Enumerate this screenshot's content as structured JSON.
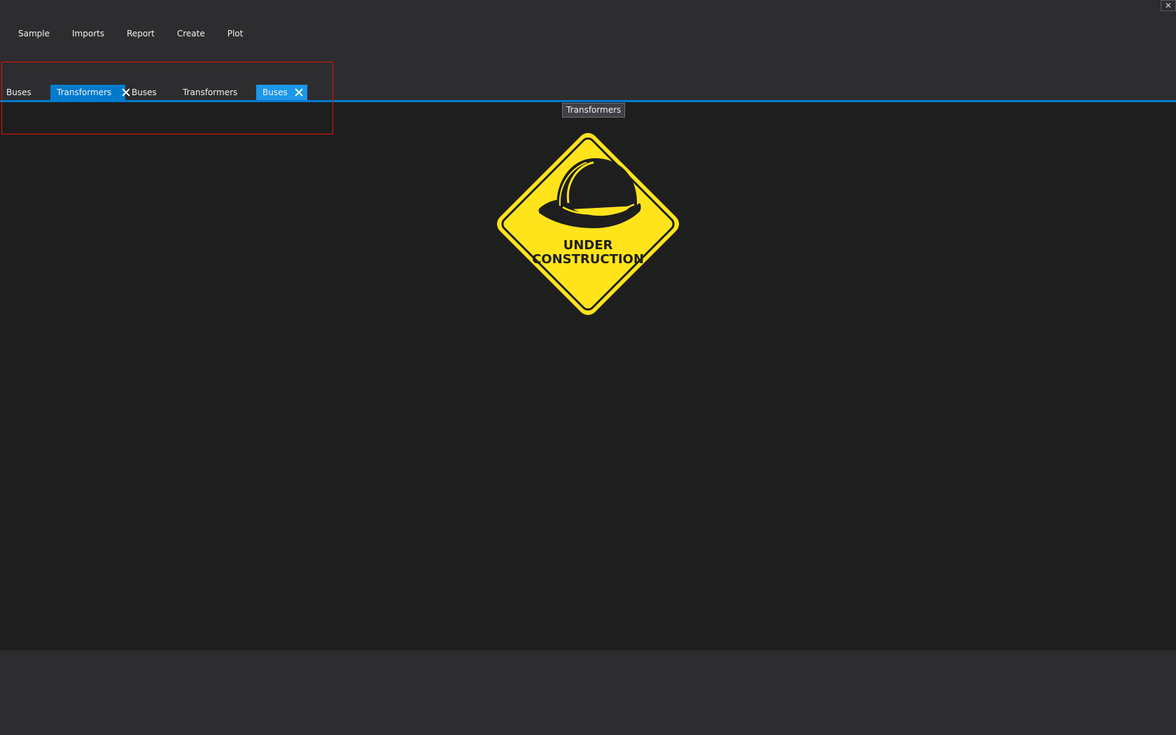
{
  "window": {
    "close_glyph": "✕"
  },
  "menu": {
    "items": [
      {
        "label": "Sample"
      },
      {
        "label": "Imports"
      },
      {
        "label": "Report"
      },
      {
        "label": "Create"
      },
      {
        "label": "Plot"
      }
    ]
  },
  "tabs": [
    {
      "label": "Buses",
      "state": "inactive"
    },
    {
      "label": "Transformers",
      "state": "active",
      "has_close": true
    },
    {
      "label": "Buses",
      "state": "inactive"
    },
    {
      "label": "Transformers",
      "state": "inactive"
    },
    {
      "label": "Buses",
      "state": "highlighted",
      "has_close": true
    }
  ],
  "tooltip": {
    "text": "Transformers"
  },
  "placeholder": {
    "line1": "UNDER",
    "line2": "CONSTRUCTION",
    "icon": "hard-hat-icon"
  },
  "colors": {
    "accent": "#007acc",
    "accent_light": "#1c97ea",
    "highlight_border": "#e51400",
    "sign_yellow": "#ffe41c"
  }
}
